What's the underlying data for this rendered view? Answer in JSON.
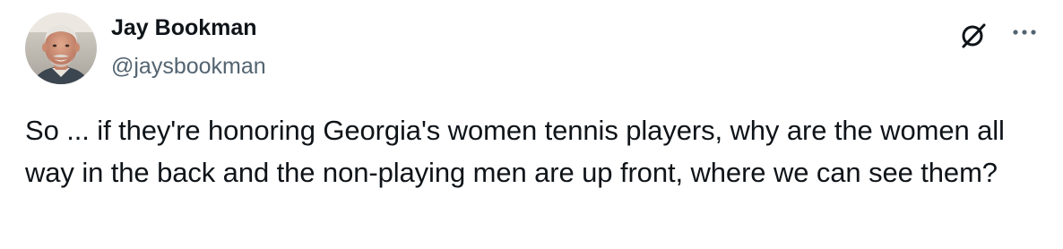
{
  "author": {
    "display_name": "Jay Bookman",
    "handle": "@jaysbookman",
    "avatar_icon": "profile-photo"
  },
  "actions": {
    "grok_icon": "grok-icon",
    "more_icon": "more-horizontal-icon"
  },
  "tweet": {
    "text": "So ... if they're honoring Georgia's women tennis players, why are the women all way in the back and the non-playing men are up front, where we can see them?"
  },
  "colors": {
    "primary_text": "#0f1419",
    "secondary_text": "#536471",
    "background": "#ffffff"
  }
}
